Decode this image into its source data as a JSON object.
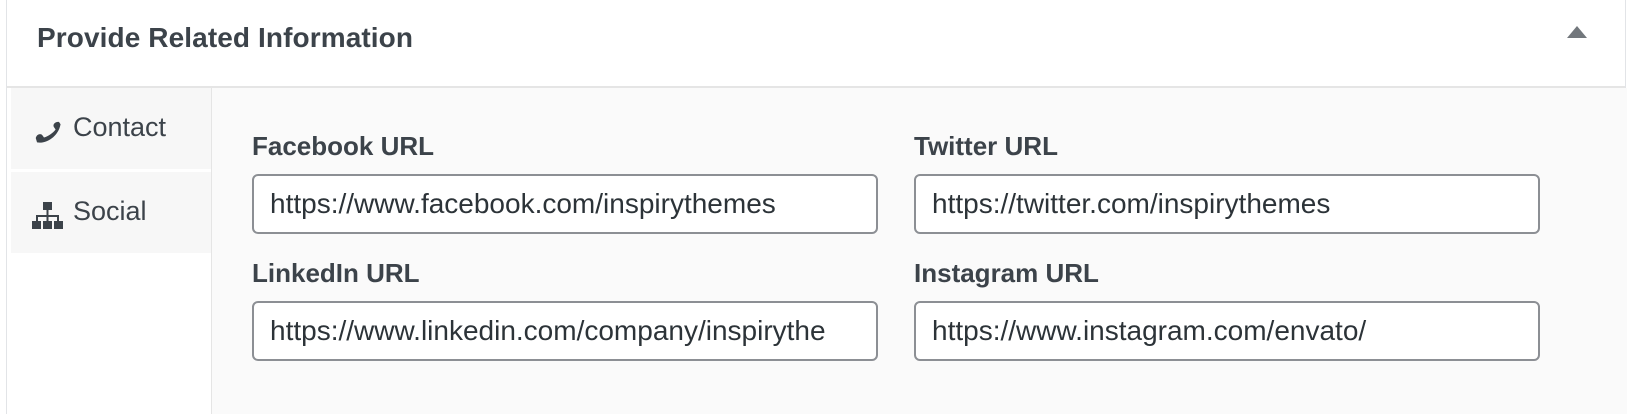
{
  "metabox": {
    "title": "Provide Related Information"
  },
  "tabs": [
    {
      "label": "Contact",
      "icon": "phone-icon"
    },
    {
      "label": "Social",
      "icon": "sitemap-icon"
    }
  ],
  "fields": {
    "facebook": {
      "label": "Facebook URL",
      "value": "https://www.facebook.com/inspirythemes"
    },
    "twitter": {
      "label": "Twitter URL",
      "value": "https://twitter.com/inspirythemes"
    },
    "linkedin": {
      "label": "LinkedIn URL",
      "value": "https://www.linkedin.com/company/inspirythe"
    },
    "instagram": {
      "label": "Instagram URL",
      "value": "https://www.instagram.com/envato/"
    }
  },
  "colors": {
    "text": "#3c434a",
    "border": "#8c8f94",
    "panel_bg": "#fafafa",
    "tab_bg": "#f7f7f7"
  }
}
